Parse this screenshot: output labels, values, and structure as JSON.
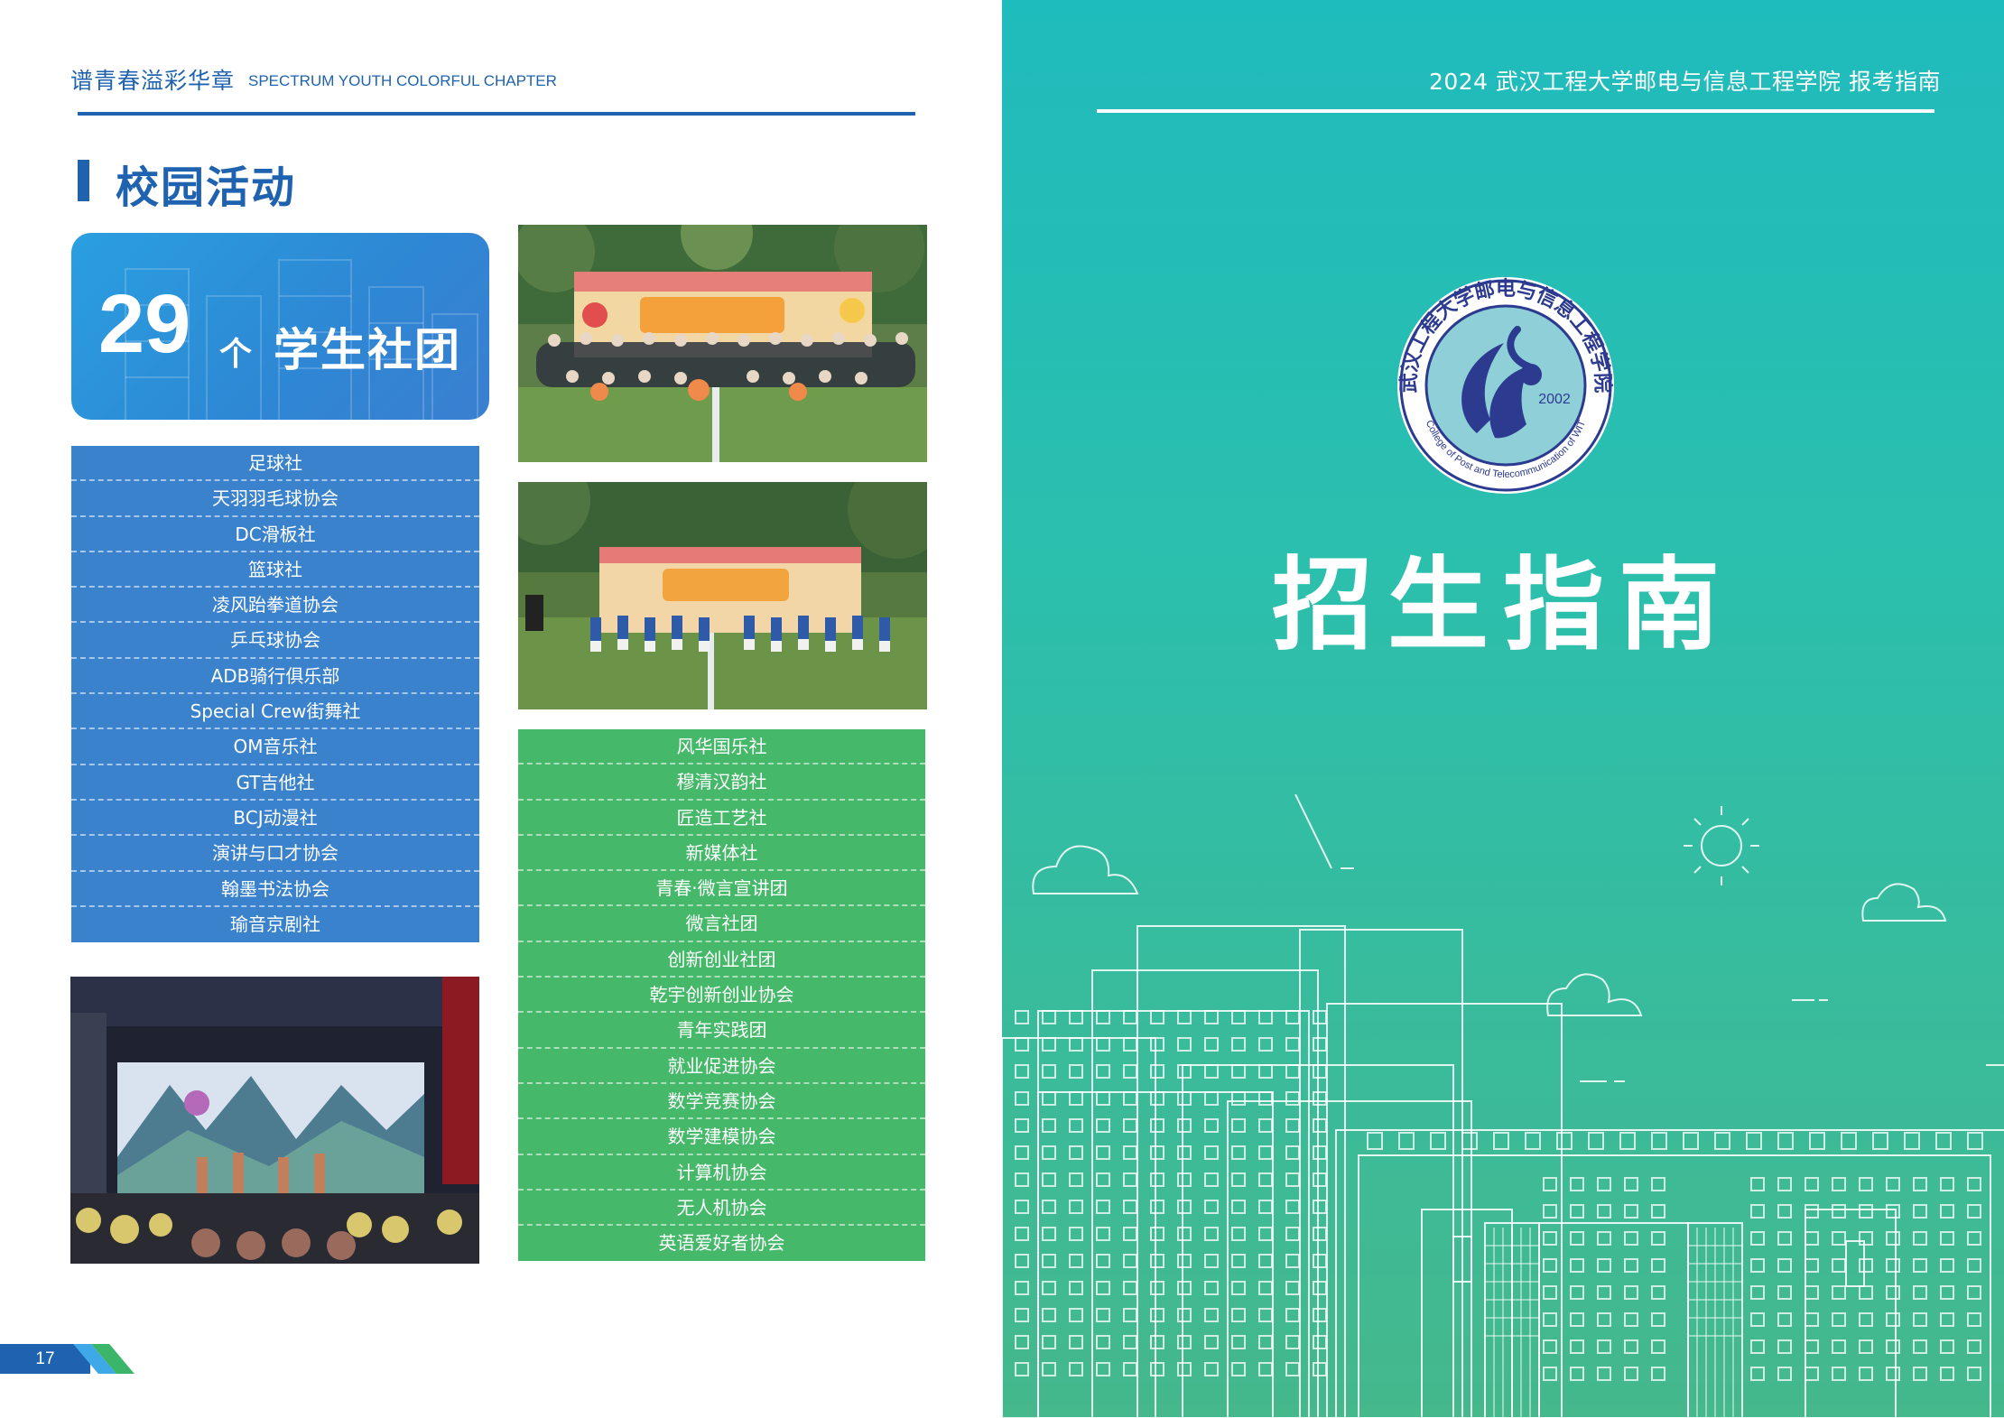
{
  "left_page": {
    "header_cn": "谱青春溢彩华章",
    "header_en": "SPECTRUM YOUTH COLORFUL CHAPTER",
    "section_title": "校园活动",
    "count_card": {
      "number": "29",
      "unit": "个",
      "label": "学生社团"
    },
    "blue_clubs": [
      "足球社",
      "天羽羽毛球协会",
      "DC滑板社",
      "篮球社",
      "凌风跆拳道协会",
      "乒乓球协会",
      "ADB骑行俱乐部",
      "Special Crew街舞社",
      "OM音乐社",
      "GT吉他社",
      "BCJ动漫社",
      "演讲与口才协会",
      "翰墨书法协会",
      "瑜音京剧社"
    ],
    "green_clubs": [
      "风华国乐社",
      "穆清汉韵社",
      "匠造工艺社",
      "新媒体社",
      "青春·微言宣讲团",
      "微言社团",
      "创新创业社团",
      "乾宇创新创业协会",
      "青年实践团",
      "就业促进协会",
      "数学竞赛协会",
      "数学建模协会",
      "计算机协会",
      "无人机协会",
      "英语爱好者协会"
    ],
    "page_number": "17",
    "colors": {
      "blue": "#1f63b0",
      "club_blue": "#3a82cc",
      "club_green": "#45b86a"
    }
  },
  "right_page": {
    "header": "2024   武汉工程大学邮电与信息工程学院   报考指南",
    "logo": {
      "year": "2002",
      "ring_text_cn": "武汉工程大学邮电与信息工程学院",
      "ring_text_en": "College of Post and Telecommunication of WIT",
      "icon": "college-emblem"
    },
    "title": "招生指南",
    "colors": {
      "gradient_top": "#1fbcbd",
      "gradient_bottom": "#45b88c"
    }
  }
}
